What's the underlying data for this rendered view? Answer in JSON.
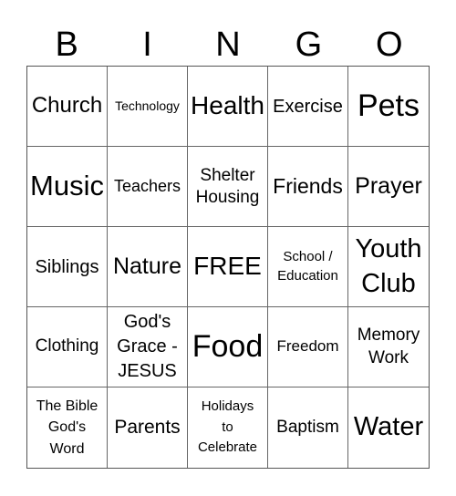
{
  "header": {
    "letters": [
      "B",
      "I",
      "N",
      "G",
      "O"
    ]
  },
  "cells": [
    {
      "text": "Church",
      "size": 24,
      "lh": 1.1
    },
    {
      "text": "Technology",
      "size": 14,
      "lh": 1.1
    },
    {
      "text": "Health",
      "size": 28,
      "lh": 1.1
    },
    {
      "text": "Exercise",
      "size": 20,
      "lh": 1.1
    },
    {
      "text": "Pets",
      "size": 34,
      "lh": 1.1
    },
    {
      "text": "Music",
      "size": 31,
      "lh": 1.1
    },
    {
      "text": "Teachers",
      "size": 18,
      "lh": 1.1
    },
    {
      "text": "Shelter\nHousing",
      "size": 19,
      "lh": 1.25
    },
    {
      "text": "Friends",
      "size": 23,
      "lh": 1.1
    },
    {
      "text": "Prayer",
      "size": 25,
      "lh": 1.1
    },
    {
      "text": "Siblings",
      "size": 20,
      "lh": 1.1
    },
    {
      "text": "Nature",
      "size": 25,
      "lh": 1.1
    },
    {
      "text": "FREE",
      "size": 28,
      "lh": 1.1
    },
    {
      "text": "School /\nEducation",
      "size": 15,
      "lh": 1.35
    },
    {
      "text": "Youth\nClub",
      "size": 29,
      "lh": 1.3
    },
    {
      "text": "Clothing",
      "size": 19,
      "lh": 1.1
    },
    {
      "text": "God's\nGrace -\nJESUS",
      "size": 20,
      "lh": 1.35
    },
    {
      "text": "Food",
      "size": 34,
      "lh": 1.1
    },
    {
      "text": "Freedom",
      "size": 17,
      "lh": 1.1
    },
    {
      "text": "Memory\nWork",
      "size": 19,
      "lh": 1.3
    },
    {
      "text": "The Bible\nGod's\nWord",
      "size": 16,
      "lh": 1.45
    },
    {
      "text": "Parents",
      "size": 21,
      "lh": 1.1
    },
    {
      "text": "Holidays\nto\nCelebrate",
      "size": 15,
      "lh": 1.5
    },
    {
      "text": "Baptism",
      "size": 19,
      "lh": 1.1
    },
    {
      "text": "Water",
      "size": 29,
      "lh": 1.1
    }
  ]
}
